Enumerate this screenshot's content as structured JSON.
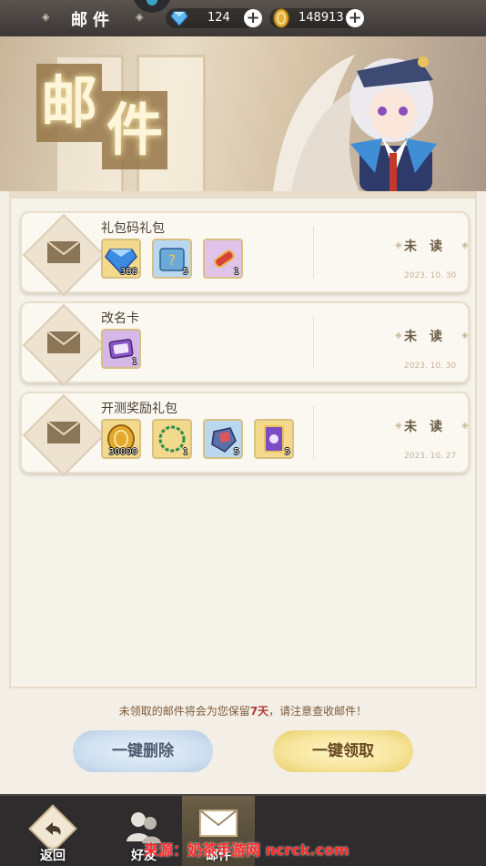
{
  "header": {
    "title": "邮件",
    "diamonds": "124",
    "coins": "148913"
  },
  "banner": {
    "char1": "邮",
    "char2": "件"
  },
  "mails": [
    {
      "subject": "礼包码礼包",
      "status": "未读",
      "date": "2023. 10. 30",
      "items": [
        {
          "icon": "diamond-icon",
          "count": "388"
        },
        {
          "icon": "mystery-book-icon",
          "count": "5"
        },
        {
          "icon": "scroll-icon",
          "count": "1"
        }
      ]
    },
    {
      "subject": "改名卡",
      "status": "未读",
      "date": "2023. 10. 30",
      "items": [
        {
          "icon": "rename-card-icon",
          "count": "1"
        }
      ]
    },
    {
      "subject": "开测奖励礼包",
      "status": "未读",
      "date": "2023. 10. 27",
      "items": [
        {
          "icon": "gold-coin-icon",
          "count": "30000"
        },
        {
          "icon": "laurel-ring-icon",
          "count": "1"
        },
        {
          "icon": "gem-ore-icon",
          "count": "5"
        },
        {
          "icon": "summon-card-icon",
          "count": "5"
        }
      ]
    }
  ],
  "notice": {
    "before": "未领取的邮件将会为您保留",
    "highlight": "7天",
    "after": "，请注意查收邮件！"
  },
  "actions": {
    "delete_all": "一键删除",
    "collect_all": "一键领取"
  },
  "nav": [
    {
      "label": "返回",
      "icon": "back-arrow-icon"
    },
    {
      "label": "好友",
      "icon": "friends-icon"
    },
    {
      "label": "邮件",
      "icon": "mail-icon"
    }
  ],
  "watermark": "来源：奶茶手游网 ncrck.com",
  "colors": {
    "accent_red": "#b0392f",
    "status_text": "#6b5a45"
  }
}
